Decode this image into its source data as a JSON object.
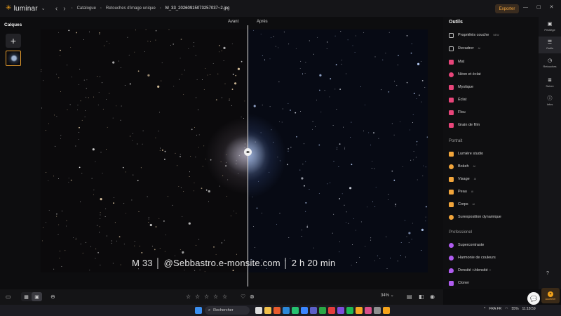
{
  "app": {
    "logo_text": "luminar",
    "export_label": "Exporter",
    "breadcrumbs": [
      "Catalogue",
      "Retouches d'image unique",
      "M_33_20260915073257037~2.jpg"
    ],
    "window_controls": [
      "—",
      "▢",
      "✕"
    ]
  },
  "layers": {
    "title": "Calques",
    "add_label": "+"
  },
  "canvas": {
    "before_label": "Avant",
    "after_label": "Après",
    "watermark": "M 33 │ @Sebbastro.e-monsite.com │ 2 h 20 min"
  },
  "tools": {
    "title": "Outils",
    "general": [
      {
        "label": "Propriétés couche",
        "badge": "NEW",
        "color": "#bdbdbd",
        "icon": "layers-icon"
      },
      {
        "label": "Recadrer",
        "badge": "AI",
        "color": "#bdbdbd",
        "icon": "crop-icon"
      }
    ],
    "creative": [
      {
        "label": "Mat",
        "color": "#e8457a",
        "icon": "matte-icon"
      },
      {
        "label": "Néon et éclat",
        "color": "#e8457a",
        "icon": "neon-icon"
      },
      {
        "label": "Mystique",
        "color": "#e8457a",
        "icon": "mystic-icon"
      },
      {
        "label": "Éclat",
        "color": "#e8457a",
        "icon": "glow-icon"
      },
      {
        "label": "Flou",
        "color": "#e8457a",
        "icon": "blur-icon"
      },
      {
        "label": "Grain de film",
        "color": "#e8457a",
        "icon": "film-grain-icon"
      }
    ],
    "portrait_title": "Portrait",
    "portrait": [
      {
        "label": "Lumière studio",
        "color": "#f2a53b",
        "icon": "studio-light-icon"
      },
      {
        "label": "Bokeh",
        "badge": "AI",
        "color": "#f2a53b",
        "icon": "bokeh-icon"
      },
      {
        "label": "Visage",
        "badge": "AI",
        "color": "#f2a53b",
        "icon": "face-icon"
      },
      {
        "label": "Peau",
        "badge": "AI",
        "color": "#f2a53b",
        "icon": "skin-icon"
      },
      {
        "label": "Corps",
        "badge": "AI",
        "color": "#f2a53b",
        "icon": "body-icon"
      },
      {
        "label": "Surexposition dynamique",
        "color": "#f2a53b",
        "icon": "dynamic-overexposure-icon"
      }
    ],
    "pro_title": "Professionel",
    "pro": [
      {
        "label": "Supercontraste",
        "color": "#b05cf0",
        "icon": "supercontrast-icon"
      },
      {
        "label": "Harmonie de couleurs",
        "color": "#b05cf0",
        "icon": "color-harmony-icon"
      },
      {
        "label": "Densité +/densité −",
        "color": "#b05cf0",
        "icon": "dodge-burn-icon"
      },
      {
        "label": "Cloner",
        "color": "#b05cf0",
        "icon": "clone-icon"
      }
    ]
  },
  "rail": [
    {
      "label": "Privilège",
      "icon": "gift-icon"
    },
    {
      "label": "Outils",
      "icon": "sliders-icon",
      "active": true
    },
    {
      "label": "Retouches",
      "icon": "history-icon"
    },
    {
      "label": "Suivre",
      "icon": "list-icon"
    },
    {
      "label": "Infos",
      "icon": "info-icon"
    }
  ],
  "accelerate_label": "Accélérer",
  "bottom": {
    "zoom": "34% ⌄"
  },
  "taskbar": {
    "search_placeholder": "Rechercher",
    "lang": "FRA FR",
    "battery": "55%",
    "time": "11:18:59"
  }
}
